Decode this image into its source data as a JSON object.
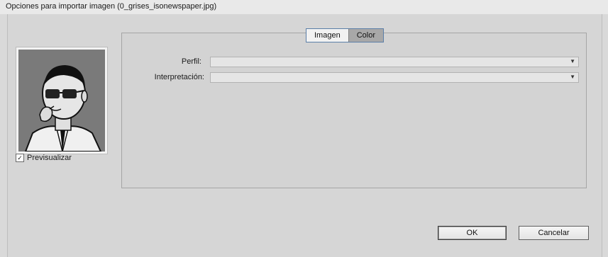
{
  "window": {
    "title": "Opciones para importar imagen (0_grises_isonewspaper.jpg)"
  },
  "preview": {
    "checkbox_label": "Previsualizar",
    "checked": true,
    "check_glyph": "✓"
  },
  "tabs": [
    {
      "label": "Imagen",
      "selected": false
    },
    {
      "label": "Color",
      "selected": true
    }
  ],
  "fields": {
    "profile": {
      "label": "Perfil:",
      "value": ""
    },
    "interpretation": {
      "label": "Interpretación:",
      "value": ""
    }
  },
  "icons": {
    "dropdown": "chevron-down-icon",
    "dropdown_glyph": "▼"
  },
  "buttons": {
    "ok": "OK",
    "cancel": "Cancelar"
  }
}
